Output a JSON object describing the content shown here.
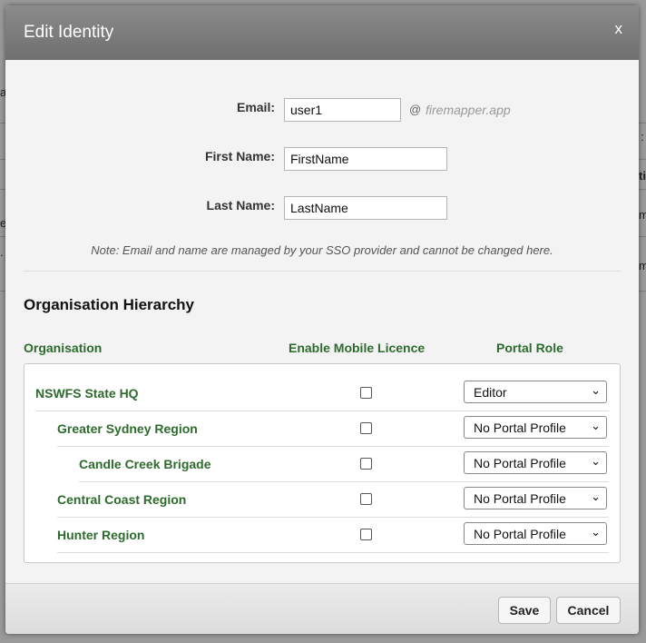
{
  "dialog": {
    "title": "Edit Identity",
    "close_label": "x"
  },
  "form": {
    "email_label": "Email:",
    "email_value": "user1",
    "at_sign": "@",
    "domain": "firemapper.app",
    "first_name_label": "First Name:",
    "first_name_value": "FirstName",
    "last_name_label": "Last Name:",
    "last_name_value": "LastName",
    "note": "Note: Email and name are managed by your SSO provider and cannot be changed here."
  },
  "hierarchy": {
    "title": "Organisation Hierarchy",
    "columns": [
      "Organisation",
      "Enable Mobile Licence",
      "Portal Role"
    ],
    "rows": [
      {
        "name": "NSWFS State HQ",
        "mobile_licence": false,
        "role": "Editor",
        "level": 0
      },
      {
        "name": "Greater Sydney Region",
        "mobile_licence": false,
        "role": "No Portal Profile",
        "level": 1
      },
      {
        "name": "Candle Creek Brigade",
        "mobile_licence": false,
        "role": "No Portal Profile",
        "level": 2
      },
      {
        "name": "Central Coast Region",
        "mobile_licence": false,
        "role": "No Portal Profile",
        "level": 1
      },
      {
        "name": "Hunter Region",
        "mobile_licence": false,
        "role": "No Portal Profile",
        "level": 1
      }
    ]
  },
  "footer": {
    "save_label": "Save",
    "cancel_label": "Cancel"
  },
  "background": {
    "left_fragments": [
      "a",
      "e",
      "."
    ],
    "right_fragments": [
      ":",
      "ti",
      "m",
      "m"
    ]
  }
}
